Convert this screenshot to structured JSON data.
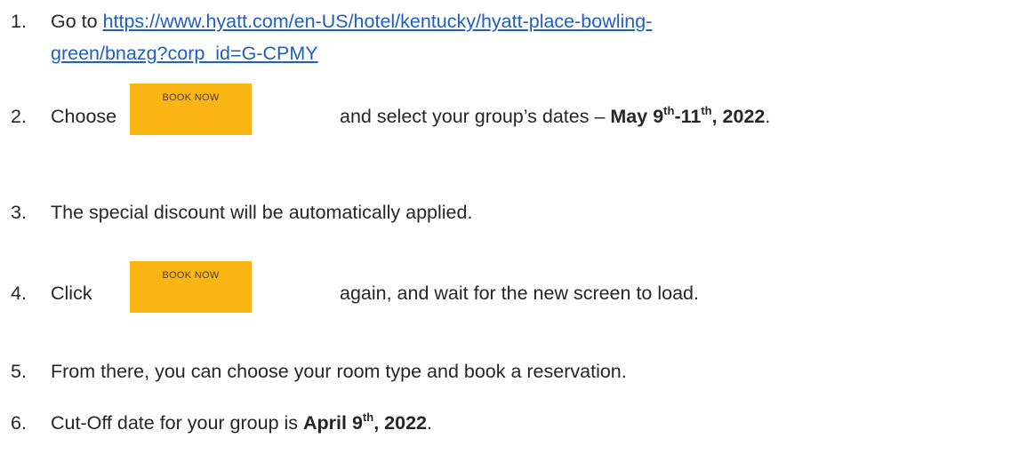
{
  "steps": [
    {
      "number": "1.",
      "prefix": "Go to ",
      "link_line1": "https://www.hyatt.com/en-US/hotel/kentucky/hyatt-place-bowling-",
      "link_line2": "green/bnazg?corp_id=G-CPMY"
    },
    {
      "number": "2.",
      "text_before": "Choose",
      "button_label": "BOOK NOW",
      "text_after": "and select your group’s dates – ",
      "dates_bold_1": "May 9",
      "sup_1": "th",
      "dates_bold_2": "-11",
      "sup_2": "th",
      "dates_bold_3": ", 2022",
      "end": "."
    },
    {
      "number": "3.",
      "text": "The special discount will be automatically applied."
    },
    {
      "number": "4.",
      "text_before": "Click",
      "button_label": "BOOK NOW",
      "text_after": "again, and wait for the new screen to load."
    },
    {
      "number": "5.",
      "text": "From there, you can choose your room type and book a reservation."
    },
    {
      "number": "6.",
      "text_before": "Cut-Off date for your group is ",
      "date_bold_1": "April 9",
      "sup": "th",
      "date_bold_2": ", 2022",
      "end": "."
    }
  ],
  "colors": {
    "link": "#1f5fbf",
    "button": "#fab515",
    "text": "#262626"
  }
}
